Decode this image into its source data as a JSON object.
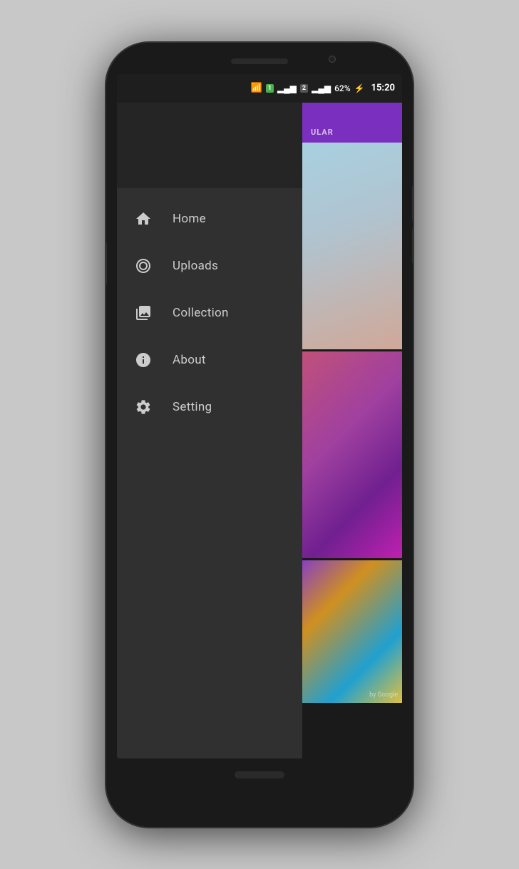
{
  "phone": {
    "status_bar": {
      "time": "15:20",
      "battery_percent": "62%",
      "battery_icon": "⚡"
    },
    "drawer": {
      "menu_items": [
        {
          "id": "home",
          "label": "Home",
          "icon": "home"
        },
        {
          "id": "uploads",
          "label": "Uploads",
          "icon": "person-circle"
        },
        {
          "id": "collection",
          "label": "Collection",
          "icon": "image"
        },
        {
          "id": "about",
          "label": "About",
          "icon": "info-circle"
        },
        {
          "id": "setting",
          "label": "Setting",
          "icon": "gear"
        }
      ]
    },
    "main": {
      "header_label": "ULAR",
      "full_header_label": "POPULAR"
    }
  }
}
